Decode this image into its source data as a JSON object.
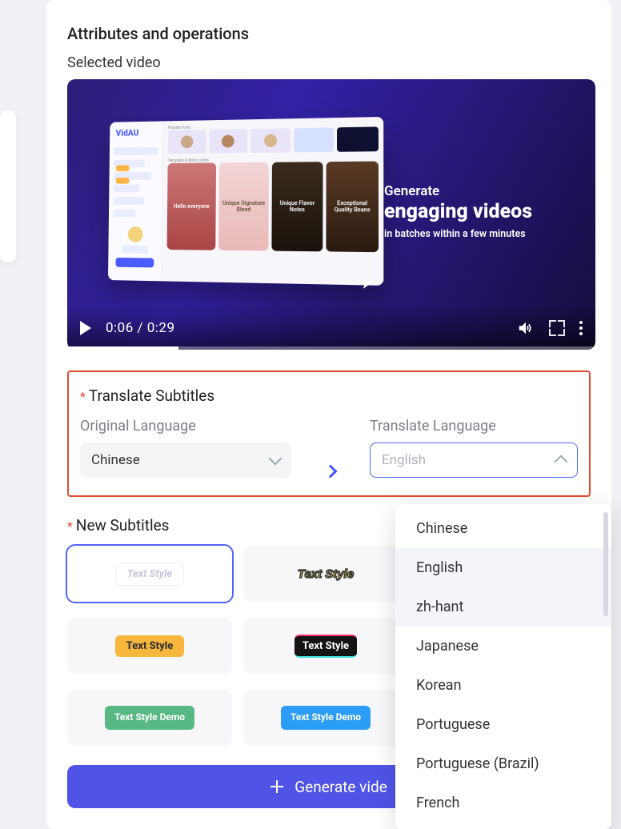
{
  "header": {
    "title": "Attributes and operations",
    "subtitle": "Selected video"
  },
  "video": {
    "mock_logo": "VidAU",
    "hero": {
      "line1": "Generate",
      "line2": "engaging videos",
      "line3": "in batches within a few minutes"
    },
    "cards": {
      "c1_sub": "Hello everyone",
      "c2": "Unique Signature Blend",
      "c3": "Unique Flavor Notes",
      "c4": "Exceptional Quality Beans"
    },
    "controls": {
      "current_time": "0:06",
      "sep": " / ",
      "duration": "0:29"
    }
  },
  "translate": {
    "title": "Translate Subtitles",
    "original_label": "Original Language",
    "original_value": "Chinese",
    "target_label": "Translate Language",
    "target_placeholder": "English",
    "options": [
      "Chinese",
      "English",
      "zh-hant",
      "Japanese",
      "Korean",
      "Portuguese",
      "Portuguese (Brazil)",
      "French"
    ]
  },
  "subtitles": {
    "title": "New Subtitles",
    "styles": [
      {
        "label": "Text Style"
      },
      {
        "label": "Text Style"
      },
      {
        "label": ""
      },
      {
        "label": "Text Style"
      },
      {
        "label": "Text Style"
      },
      {
        "label": ""
      },
      {
        "label": "Text Style Demo"
      },
      {
        "label": "Text Style Demo"
      },
      {
        "label": ""
      }
    ],
    "selected_index": 0
  },
  "generate_label": "Generate vide"
}
